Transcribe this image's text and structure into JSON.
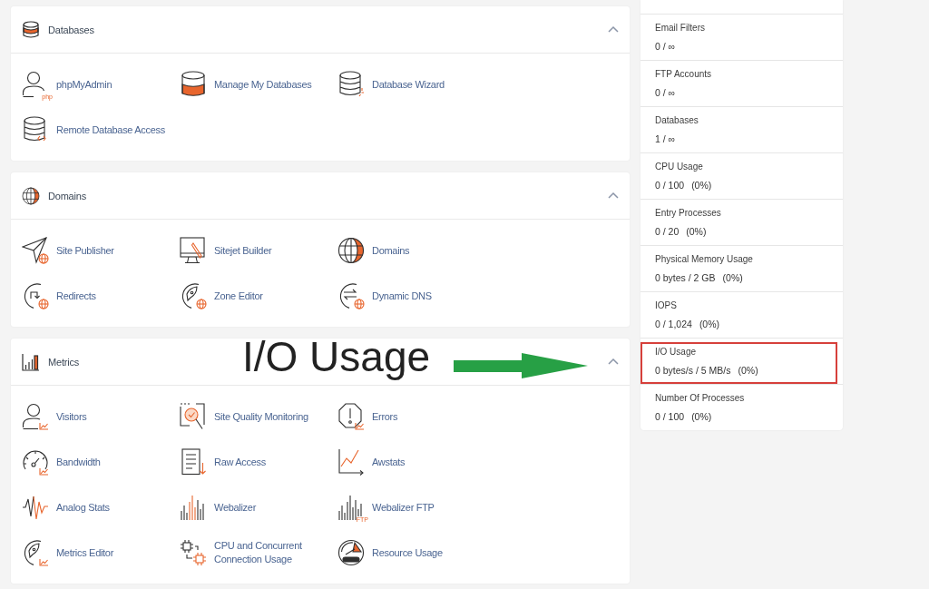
{
  "sections": [
    {
      "title": "Databases",
      "expanded": true,
      "items": [
        {
          "label": "phpMyAdmin",
          "icon_tag": "php"
        },
        {
          "label": "Manage My Databases"
        },
        {
          "label": "Database Wizard"
        },
        {
          "label": "Remote Database Access"
        }
      ]
    },
    {
      "title": "Domains",
      "expanded": true,
      "items": [
        {
          "label": "Site Publisher"
        },
        {
          "label": "Sitejet Builder"
        },
        {
          "label": "Domains"
        },
        {
          "label": "Redirects"
        },
        {
          "label": "Zone Editor"
        },
        {
          "label": "Dynamic DNS"
        }
      ]
    },
    {
      "title": "Metrics",
      "expanded": true,
      "items": [
        {
          "label": "Visitors"
        },
        {
          "label": "Site Quality Monitoring"
        },
        {
          "label": "Errors"
        },
        {
          "label": "Bandwidth"
        },
        {
          "label": "Raw Access"
        },
        {
          "label": "Awstats"
        },
        {
          "label": "Analog Stats"
        },
        {
          "label": "Webalizer"
        },
        {
          "label": "Webalizer FTP",
          "icon_tag": "FTP"
        },
        {
          "label": "Metrics Editor"
        },
        {
          "label": "CPU and Concurrent Connection Usage"
        },
        {
          "label": "Resource Usage"
        }
      ]
    }
  ],
  "stats": [
    {
      "label": "Email Filters",
      "value": "0 / ∞",
      "highlighted": false
    },
    {
      "label": "FTP Accounts",
      "value": "0 / ∞",
      "highlighted": false
    },
    {
      "label": "Databases",
      "value": "1 / ∞",
      "highlighted": false
    },
    {
      "label": "CPU Usage",
      "value": "0 / 100",
      "percent": "(0%)",
      "highlighted": false
    },
    {
      "label": "Entry Processes",
      "value": "0 / 20",
      "percent": "(0%)",
      "highlighted": false
    },
    {
      "label": "Physical Memory Usage",
      "value": "0 bytes / 2 GB",
      "percent": "(0%)",
      "highlighted": false
    },
    {
      "label": "IOPS",
      "value": "0 / 1,024",
      "percent": "(0%)",
      "highlighted": false
    },
    {
      "label": "I/O Usage",
      "value": "0 bytes/s / 5 MB/s",
      "percent": "(0%)",
      "highlighted": true
    },
    {
      "label": "Number Of Processes",
      "value": "0 / 100",
      "percent": "(0%)",
      "highlighted": false
    }
  ],
  "annotation": {
    "text": "I/O Usage"
  }
}
